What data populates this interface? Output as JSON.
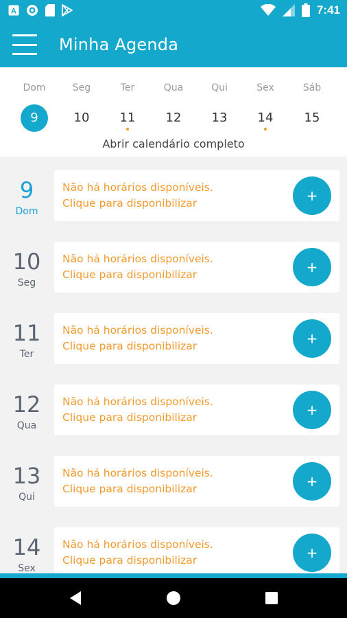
{
  "status_bar": {
    "time": "7:41",
    "left_icons": [
      "font-icon",
      "circle-icon",
      "sd-card-icon",
      "play-store-icon"
    ],
    "right_icons": [
      "wifi-icon",
      "signal-icon",
      "battery-icon"
    ]
  },
  "app_bar": {
    "title": "Minha Agenda",
    "menu_icon": "hamburger-icon"
  },
  "week": {
    "days": [
      {
        "name": "Dom",
        "num": "9",
        "selected": true,
        "dot": false
      },
      {
        "name": "Seg",
        "num": "10",
        "selected": false,
        "dot": false
      },
      {
        "name": "Ter",
        "num": "11",
        "selected": false,
        "dot": true
      },
      {
        "name": "Qua",
        "num": "12",
        "selected": false,
        "dot": false
      },
      {
        "name": "Qui",
        "num": "13",
        "selected": false,
        "dot": false
      },
      {
        "name": "Sex",
        "num": "14",
        "selected": false,
        "dot": true
      },
      {
        "name": "Sáb",
        "num": "15",
        "selected": false,
        "dot": false
      }
    ],
    "open_calendar": "Abrir calendário completo"
  },
  "schedule": {
    "items": [
      {
        "num": "9",
        "name": "Dom",
        "today": true,
        "line1": "Não há horários disponíveis.",
        "line2": "Clique para disponibilizar",
        "add_label": "+"
      },
      {
        "num": "10",
        "name": "Seg",
        "today": false,
        "line1": "Não há horários disponíveis.",
        "line2": "Clique para disponibilizar",
        "add_label": "+"
      },
      {
        "num": "11",
        "name": "Ter",
        "today": false,
        "line1": "Não há horários disponíveis.",
        "line2": "Clique para disponibilizar",
        "add_label": "+"
      },
      {
        "num": "12",
        "name": "Qua",
        "today": false,
        "line1": "Não há horários disponíveis.",
        "line2": "Clique para disponibilizar",
        "add_label": "+"
      },
      {
        "num": "13",
        "name": "Qui",
        "today": false,
        "line1": "Não há horários disponíveis.",
        "line2": "Clique para disponibilizar",
        "add_label": "+"
      },
      {
        "num": "14",
        "name": "Sex",
        "today": false,
        "line1": "Não há horários disponíveis.",
        "line2": "Clique para disponibilizar",
        "add_label": "+"
      }
    ]
  },
  "colors": {
    "primary": "#13a8cc",
    "accent_orange": "#f29a2e",
    "today_blue": "#1aa1d8",
    "day_gray": "#5a6472"
  },
  "nav_bar": {
    "icons": [
      "back-icon",
      "home-icon",
      "recents-icon"
    ]
  }
}
